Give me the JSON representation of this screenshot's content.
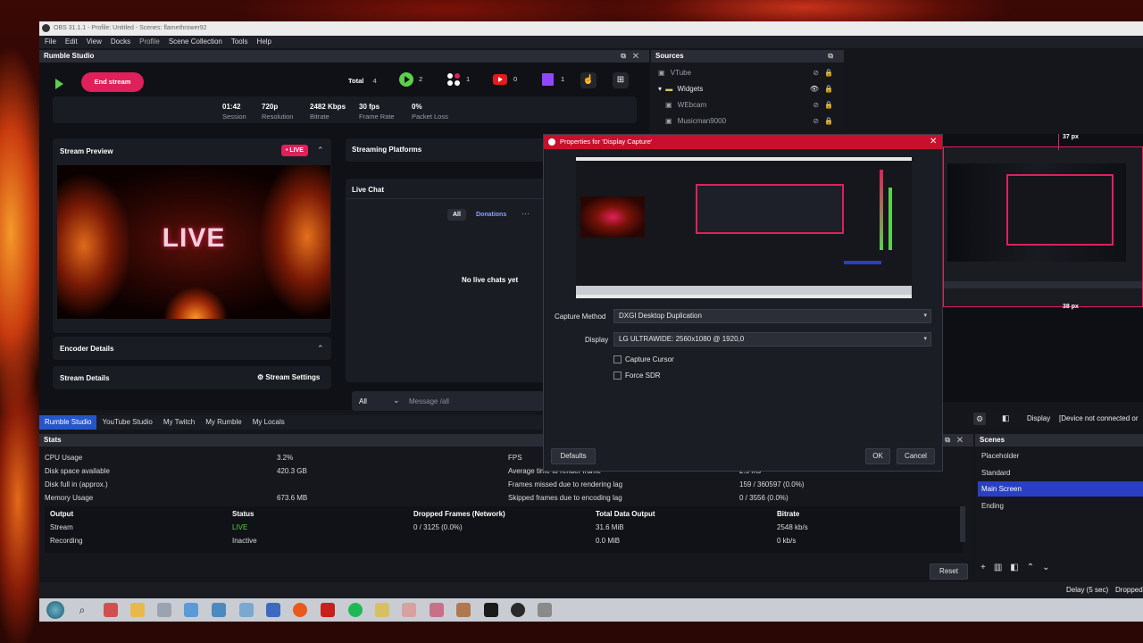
{
  "window": {
    "title": "OBS 31.1.1 - Profile: Untitled - Scenes: flamethrower92"
  },
  "menu": [
    "File",
    "Edit",
    "View",
    "Docks",
    "Profile",
    "Scene Collection",
    "Tools",
    "Help"
  ],
  "rumble": {
    "dock_title": "Rumble Studio",
    "end_stream": "End stream",
    "platforms": {
      "total_label": "Total",
      "total_count": "4",
      "rumble_count": "2",
      "multi_count": "1",
      "youtube_count": "0",
      "twitch_count": "1"
    },
    "stats": [
      {
        "value": "01:42",
        "label": "Session"
      },
      {
        "value": "720p",
        "label": "Resolution"
      },
      {
        "value": "2482 Kbps",
        "label": "Bitrate"
      },
      {
        "value": "30 fps",
        "label": "Frame Rate"
      },
      {
        "value": "0%",
        "label": "Packet Loss"
      }
    ],
    "stream_preview_title": "Stream Preview",
    "live_badge": "• LIVE",
    "preview_text": "LIVE",
    "encoder_details": "Encoder Details",
    "stream_details": "Stream Details",
    "stream_settings": "Stream Settings",
    "streaming_platforms": "Streaming Platforms",
    "live_chat": "Live Chat",
    "chat_tab_all": "All",
    "chat_tab_donations": "Donations",
    "no_chats": "No live chats yet",
    "chat_target": "All",
    "message_placeholder": "Message /all"
  },
  "tabs": [
    "Rumble Studio",
    "YouTube Studio",
    "My Twitch",
    "My Rumble",
    "My Locals"
  ],
  "sources": {
    "title": "Sources",
    "items": [
      {
        "name": "VTube",
        "indent": false
      },
      {
        "name": "Widgets",
        "indent": false,
        "group": true
      },
      {
        "name": "WEbcam",
        "indent": true
      },
      {
        "name": "Musicman9000",
        "indent": true
      }
    ]
  },
  "preview": {
    "top_measure": "37 px",
    "bottom_measure": "38 px"
  },
  "display_bar": {
    "label": "Display",
    "value": "[Device not connected or"
  },
  "stats": {
    "title": "Stats",
    "left": [
      {
        "label": "CPU Usage",
        "value": "3.2%"
      },
      {
        "label": "Disk space available",
        "value": "420.3 GB"
      },
      {
        "label": "Disk full in (approx.)",
        "value": ""
      },
      {
        "label": "Memory Usage",
        "value": "673.6 MB"
      }
    ],
    "right": [
      {
        "label": "FPS",
        "value": ""
      },
      {
        "label": "Average time to render frame",
        "value": "2.5 ms"
      },
      {
        "label": "Frames missed due to rendering lag",
        "value": "159 / 360597 (0.0%)"
      },
      {
        "label": "Skipped frames due to encoding lag",
        "value": "0 / 3556 (0.0%)"
      }
    ],
    "table_headers": [
      "Output",
      "Status",
      "Dropped Frames (Network)",
      "Total Data Output",
      "Bitrate"
    ],
    "rows": [
      [
        "Stream",
        "LIVE",
        "0 / 3125 (0.0%)",
        "31.6 MiB",
        "2548 kb/s"
      ],
      [
        "Recording",
        "Inactive",
        "",
        "0.0 MiB",
        "0 kb/s"
      ]
    ],
    "reset": "Reset"
  },
  "scenes": {
    "title": "Scenes",
    "items": [
      "Placeholder",
      "Standard",
      "Main Screen",
      "Ending"
    ],
    "active_index": 2
  },
  "status_right": {
    "delay": "Delay (5 sec)",
    "dropped": "Dropped"
  },
  "dialog": {
    "title": "Properties for 'Display Capture'",
    "capture_method_label": "Capture Method",
    "capture_method_value": "DXGI Desktop Duplication",
    "display_label": "Display",
    "display_value": "LG ULTRAWIDE: 2560x1080 @ 1920,0",
    "capture_cursor": "Capture Cursor",
    "force_sdr": "Force SDR",
    "defaults": "Defaults",
    "ok": "OK",
    "cancel": "Cancel"
  },
  "colors": {
    "accent": "#e0205a",
    "live_green": "#5bd14a",
    "dialog_red": "#c8102e",
    "scene_active": "#2a3fc4",
    "tab_active": "#2456c8"
  }
}
